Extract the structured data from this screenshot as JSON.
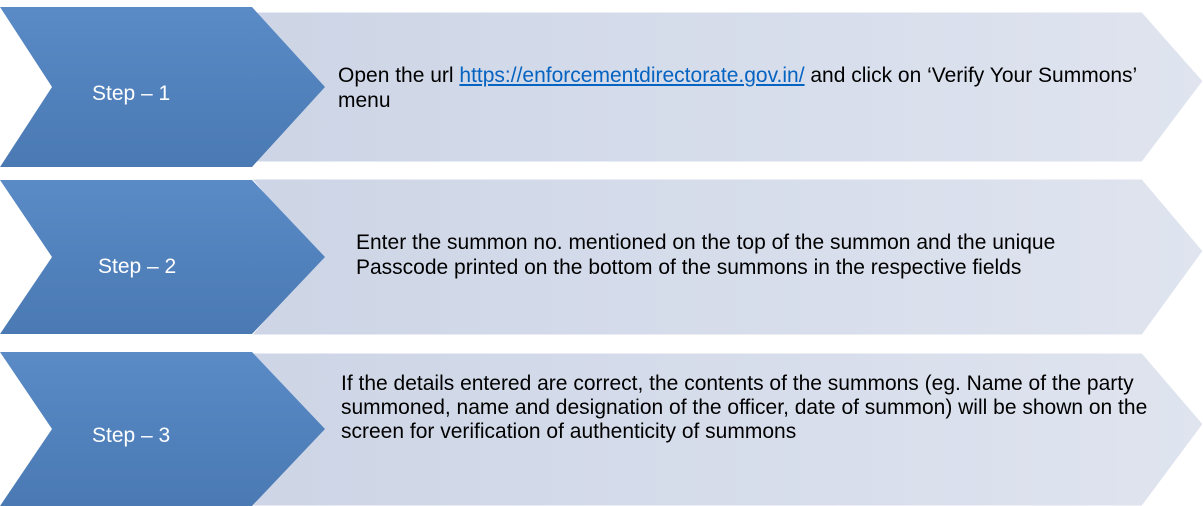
{
  "steps": [
    {
      "label": "Step – 1",
      "text_parts": [
        "Open the url ",
        "https://enforcementdirectorate.gov.in/",
        " and click on ‘Verify Your Summons’ menu"
      ]
    },
    {
      "label": "Step – 2",
      "text": "Enter the summon no. mentioned on the top of the summon and the unique Passcode printed on the bottom of the summons in the respective fields"
    },
    {
      "label": "Step – 3",
      "text": "If the details entered are correct, the contents of the summons (eg. Name of the party summoned, name and designation of the officer, date of summon) will be shown on the screen for verification of authenticity of summons"
    }
  ],
  "colors": {
    "chevron_blue": "#4f81bd",
    "panel_fill": "#d6dcea"
  }
}
